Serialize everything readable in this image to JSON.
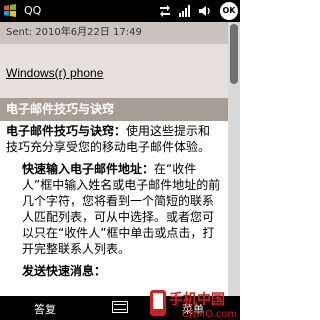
{
  "status_bar": {
    "title": "QQ",
    "ok_label": "OK",
    "icons": [
      "windows-start-icon",
      "sync-icon",
      "signal-icon",
      "speaker-icon"
    ]
  },
  "message": {
    "sent": "Sent: 2010年6月22日 17:49",
    "subject": "Windows(r) phone"
  },
  "body": {
    "section_title": "电子邮件技巧与诀窍",
    "intro_bold": "电子邮件技巧与诀窍：",
    "intro_text": "使用这些提示和技巧充分享受您的移动电子邮件体验。",
    "tip1_bold": "快速输入电子邮件地址：",
    "tip1_text": "在“收件人”框中输入姓名或电子邮件地址的前几个字符，您将看到一个简短的联系人匹配列表，可从中选择。或者您可以只在“收件人”框中单击或点击，打开完整联系人列表。",
    "tip2_partial": "发送快速消息："
  },
  "soft_keys": {
    "left": "答复",
    "right": "菜单"
  },
  "watermark": {
    "brand": "手机中国",
    "site": "CNMO.com"
  },
  "colors": {
    "status_bg": "#000000",
    "header_bg": "#e6e1dc",
    "sent_bg": "#c9c4bf",
    "band_bg": "#a79d95",
    "watermark_red": "#d21e1e"
  }
}
